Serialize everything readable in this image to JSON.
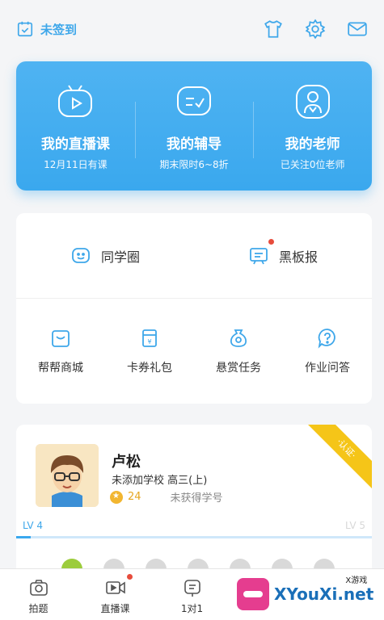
{
  "header": {
    "signin_label": "未签到",
    "icons": [
      "calendar-check-icon",
      "tshirt-icon",
      "gear-icon",
      "mail-icon"
    ]
  },
  "hero": {
    "items": [
      {
        "title": "我的直播课",
        "subtitle": "12月11日有课",
        "icon": "tv-play-icon"
      },
      {
        "title": "我的辅导",
        "subtitle": "期末限时6~8折",
        "icon": "chat-check-icon"
      },
      {
        "title": "我的老师",
        "subtitle": "已关注0位老师",
        "icon": "teacher-icon"
      }
    ]
  },
  "menu": {
    "primary": [
      {
        "label": "同学圈",
        "icon": "smile-chat-icon"
      },
      {
        "label": "黑板报",
        "icon": "board-icon",
        "has_dot": true
      }
    ],
    "secondary": [
      {
        "label": "帮帮商城",
        "icon": "shopping-bag-icon"
      },
      {
        "label": "卡券礼包",
        "icon": "coupon-icon"
      },
      {
        "label": "悬赏任务",
        "icon": "money-bag-icon"
      },
      {
        "label": "作业问答",
        "icon": "question-bubble-icon"
      }
    ]
  },
  "profile": {
    "name": "卢松",
    "school": "未添加学校  高三(上)",
    "coins": "24",
    "student_id": "未获得学号",
    "ribbon": "·认证·",
    "level_label": "LV 4",
    "next_level_label": "LV 5",
    "level_progress": 0.04,
    "badges": [
      true,
      false,
      false,
      false,
      false,
      false,
      false
    ]
  },
  "tabbar": {
    "items": [
      {
        "label": "拍题",
        "icon": "camera-icon"
      },
      {
        "label": "直播课",
        "icon": "video-icon",
        "has_dot": true
      },
      {
        "label": "1对1",
        "icon": "one-on-one-icon"
      }
    ]
  },
  "watermark": {
    "small": "X游戏",
    "big": "XYouXi.net"
  },
  "colors": {
    "accent": "#3aa8ee",
    "alert_dot": "#e74c3c",
    "coin": "#f2b630"
  }
}
